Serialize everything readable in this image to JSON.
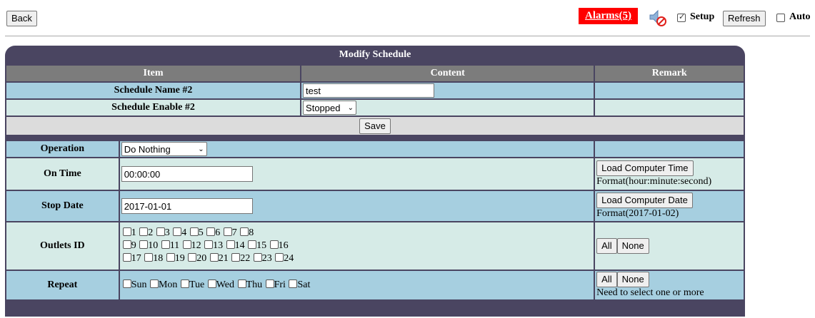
{
  "topbar": {
    "back_label": "Back",
    "alarms_label": "Alarms(5)",
    "setup_label": "Setup",
    "setup_checked": true,
    "refresh_label": "Refresh",
    "auto_label": "Auto",
    "auto_checked": false,
    "mute_icon": "speaker-muted-icon"
  },
  "panel": {
    "title": "Modify Schedule",
    "headers": {
      "item": "Item",
      "content": "Content",
      "remark": "Remark"
    },
    "schedule_name_label": "Schedule Name #2",
    "schedule_name_value": "test",
    "schedule_enable_label": "Schedule Enable #2",
    "schedule_enable_value": "Stopped",
    "save_label": "Save",
    "operation_label": "Operation",
    "operation_value": "Do Nothing",
    "on_time_label": "On Time",
    "on_time_value": "00:00:00",
    "load_time_label": "Load Computer Time",
    "time_format": "Format(hour:minute:second)",
    "stop_date_label": "Stop Date",
    "stop_date_value": "2017-01-01",
    "load_date_label": "Load Computer Date",
    "date_format": "Format(2017-01-02)",
    "outlets_label": "Outlets ID",
    "outlets_rows": [
      [
        "1",
        "2",
        "3",
        "4",
        "5",
        "6",
        "7",
        "8"
      ],
      [
        "9",
        "10",
        "11",
        "12",
        "13",
        "14",
        "15",
        "16"
      ],
      [
        "17",
        "18",
        "19",
        "20",
        "21",
        "22",
        "23",
        "24"
      ]
    ],
    "all_label": "All",
    "none_label": "None",
    "repeat_label": "Repeat",
    "days": [
      "Sun",
      "Mon",
      "Tue",
      "Wed",
      "Thu",
      "Fri",
      "Sat"
    ],
    "repeat_note": "Need to select one or more"
  },
  "colors": {
    "panel_bg": "#4a4561",
    "header_bg": "#7c7c7c",
    "row_blue": "#a6cfe0",
    "row_green": "#d6ebe7",
    "alarm_red": "#ff0000"
  }
}
